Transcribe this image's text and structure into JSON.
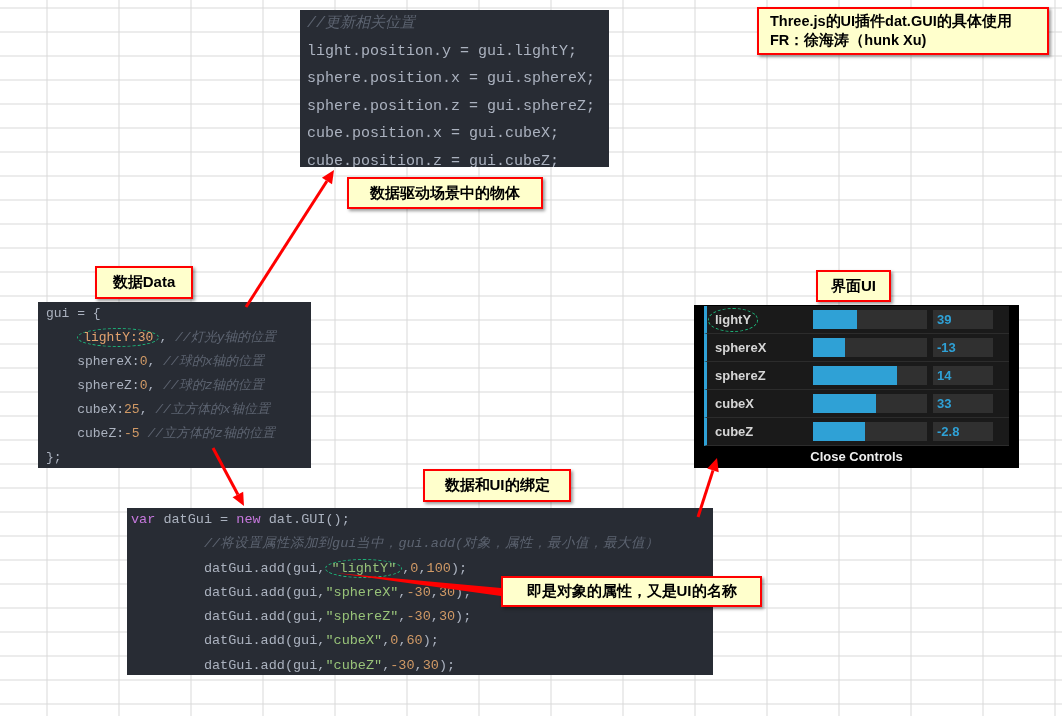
{
  "title_note": {
    "lines": [
      "Three.js的UI插件dat.GUI的具体使用",
      "FR：徐海涛（hunk Xu)"
    ]
  },
  "callouts": [
    {
      "text": "数据驱动场景中的物体"
    },
    {
      "text": "数据Data"
    },
    {
      "text": "界面UI"
    },
    {
      "text": "数据和UI的绑定"
    },
    {
      "text": "即是对象的属性，又是UI的名称"
    }
  ],
  "code_panels": [
    {
      "lines": [
        {
          "indented": false,
          "tokens": [
            {
              "text": "//更新相关位置",
              "kind": "comment",
              "circled": false
            }
          ]
        },
        {
          "indented": false,
          "tokens": [
            {
              "text": "light.position.y = gui.lightY;",
              "kind": "plain",
              "circled": false
            }
          ]
        },
        {
          "indented": false,
          "tokens": [
            {
              "text": "sphere.position.x = gui.sphereX;",
              "kind": "plain",
              "circled": false
            }
          ]
        },
        {
          "indented": false,
          "tokens": [
            {
              "text": "sphere.position.z = gui.sphereZ;",
              "kind": "plain",
              "circled": false
            }
          ]
        },
        {
          "indented": false,
          "tokens": [
            {
              "text": "cube.position.x = gui.cubeX;",
              "kind": "plain",
              "circled": false
            }
          ]
        },
        {
          "indented": false,
          "tokens": [
            {
              "text": "cube.position.z = gui.cubeZ;",
              "kind": "plain",
              "circled": false
            }
          ]
        }
      ]
    },
    {
      "lines": [
        {
          "indented": false,
          "tokens": [
            {
              "text": "gui = {",
              "kind": "plain",
              "circled": false
            }
          ]
        },
        {
          "indented": true,
          "tokens": [
            {
              "text": "lightY:30",
              "kind": "property",
              "circled": true
            },
            {
              "text": ",",
              "kind": "plain",
              "circled": false
            },
            {
              "text": "//灯光y轴的位置",
              "kind": "comment",
              "circled": false
            }
          ]
        },
        {
          "indented": true,
          "tokens": [
            {
              "text": "sphereX:",
              "kind": "plain",
              "circled": false
            },
            {
              "text": "0",
              "kind": "number",
              "circled": false
            },
            {
              "text": ",",
              "kind": "plain",
              "circled": false
            },
            {
              "text": "//球的x轴的位置",
              "kind": "comment",
              "circled": false
            }
          ]
        },
        {
          "indented": true,
          "tokens": [
            {
              "text": "sphereZ:",
              "kind": "plain",
              "circled": false
            },
            {
              "text": "0",
              "kind": "number",
              "circled": false
            },
            {
              "text": ",",
              "kind": "plain",
              "circled": false
            },
            {
              "text": "//球的z轴的位置",
              "kind": "comment",
              "circled": false
            }
          ]
        },
        {
          "indented": true,
          "tokens": [
            {
              "text": "cubeX:",
              "kind": "plain",
              "circled": false
            },
            {
              "text": "25",
              "kind": "number",
              "circled": false
            },
            {
              "text": ",",
              "kind": "plain",
              "circled": false
            },
            {
              "text": "//立方体的x轴位置",
              "kind": "comment",
              "circled": false
            }
          ]
        },
        {
          "indented": true,
          "tokens": [
            {
              "text": "cubeZ:",
              "kind": "plain",
              "circled": false
            },
            {
              "text": "-5",
              "kind": "number",
              "circled": false
            },
            {
              "text": "//立方体的z轴的位置",
              "kind": "comment",
              "circled": false
            }
          ]
        },
        {
          "indented": false,
          "tokens": [
            {
              "text": "};",
              "kind": "plain",
              "circled": false
            }
          ]
        }
      ]
    },
    {
      "lines": [
        {
          "indented": false,
          "tokens": [
            {
              "text": "var",
              "kind": "keyword",
              "circled": false
            },
            {
              "text": " datGui = ",
              "kind": "plain",
              "circled": false
            },
            {
              "text": "new",
              "kind": "keyword",
              "circled": false
            },
            {
              "text": " dat.GUI();",
              "kind": "plain",
              "circled": false
            }
          ]
        },
        {
          "indented": true,
          "tokens": [
            {
              "text": "//将设置属性添加到gui当中，gui.add(对象，属性，最小值，最大值）",
              "kind": "comment",
              "circled": false
            }
          ]
        },
        {
          "indented": true,
          "tokens": [
            {
              "text": "datGui.add(gui,",
              "kind": "plain",
              "circled": false
            },
            {
              "text": "\"lightY\"",
              "kind": "string",
              "circled": true
            },
            {
              "text": ",",
              "kind": "plain",
              "circled": false
            },
            {
              "text": "0",
              "kind": "number",
              "circled": false
            },
            {
              "text": ",",
              "kind": "plain",
              "circled": false
            },
            {
              "text": "100",
              "kind": "number",
              "circled": false
            },
            {
              "text": ");",
              "kind": "plain",
              "circled": false
            }
          ]
        },
        {
          "indented": true,
          "tokens": [
            {
              "text": "datGui.add(gui,",
              "kind": "plain",
              "circled": false
            },
            {
              "text": "\"sphereX\"",
              "kind": "string",
              "circled": false
            },
            {
              "text": ",",
              "kind": "plain",
              "circled": false
            },
            {
              "text": "-30",
              "kind": "number",
              "circled": false
            },
            {
              "text": ",",
              "kind": "plain",
              "circled": false
            },
            {
              "text": "30",
              "kind": "number",
              "circled": false
            },
            {
              "text": ");",
              "kind": "plain",
              "circled": false
            }
          ]
        },
        {
          "indented": true,
          "tokens": [
            {
              "text": "datGui.add(gui,",
              "kind": "plain",
              "circled": false
            },
            {
              "text": "\"sphereZ\"",
              "kind": "string",
              "circled": false
            },
            {
              "text": ",",
              "kind": "plain",
              "circled": false
            },
            {
              "text": "-30",
              "kind": "number",
              "circled": false
            },
            {
              "text": ",",
              "kind": "plain",
              "circled": false
            },
            {
              "text": "30",
              "kind": "number",
              "circled": false
            },
            {
              "text": ");",
              "kind": "plain",
              "circled": false
            }
          ]
        },
        {
          "indented": true,
          "tokens": [
            {
              "text": "datGui.add(gui,",
              "kind": "plain",
              "circled": false
            },
            {
              "text": "\"cubeX\"",
              "kind": "string",
              "circled": false
            },
            {
              "text": ",",
              "kind": "plain",
              "circled": false
            },
            {
              "text": "0",
              "kind": "number",
              "circled": false
            },
            {
              "text": ",",
              "kind": "plain",
              "circled": false
            },
            {
              "text": "60",
              "kind": "number",
              "circled": false
            },
            {
              "text": ");",
              "kind": "plain",
              "circled": false
            }
          ]
        },
        {
          "indented": true,
          "tokens": [
            {
              "text": "datGui.add(gui,",
              "kind": "plain",
              "circled": false
            },
            {
              "text": "\"cubeZ\"",
              "kind": "string",
              "circled": false
            },
            {
              "text": ",",
              "kind": "plain",
              "circled": false
            },
            {
              "text": "-30",
              "kind": "number",
              "circled": false
            },
            {
              "text": ",",
              "kind": "plain",
              "circled": false
            },
            {
              "text": "30",
              "kind": "number",
              "circled": false
            },
            {
              "text": ");",
              "kind": "plain",
              "circled": false
            }
          ]
        }
      ]
    }
  ],
  "gui": {
    "controllers": [
      {
        "name": "lightY",
        "value": "39",
        "level": 0.39,
        "circled": true
      },
      {
        "name": "sphereX",
        "value": "-13",
        "level": 0.283,
        "circled": false
      },
      {
        "name": "sphereZ",
        "value": "14",
        "level": 0.733,
        "circled": false
      },
      {
        "name": "cubeX",
        "value": "33",
        "level": 0.55,
        "circled": false
      },
      {
        "name": "cubeZ",
        "value": "-2.8",
        "level": 0.453,
        "circled": false
      }
    ],
    "close_button": "Close Controls"
  }
}
